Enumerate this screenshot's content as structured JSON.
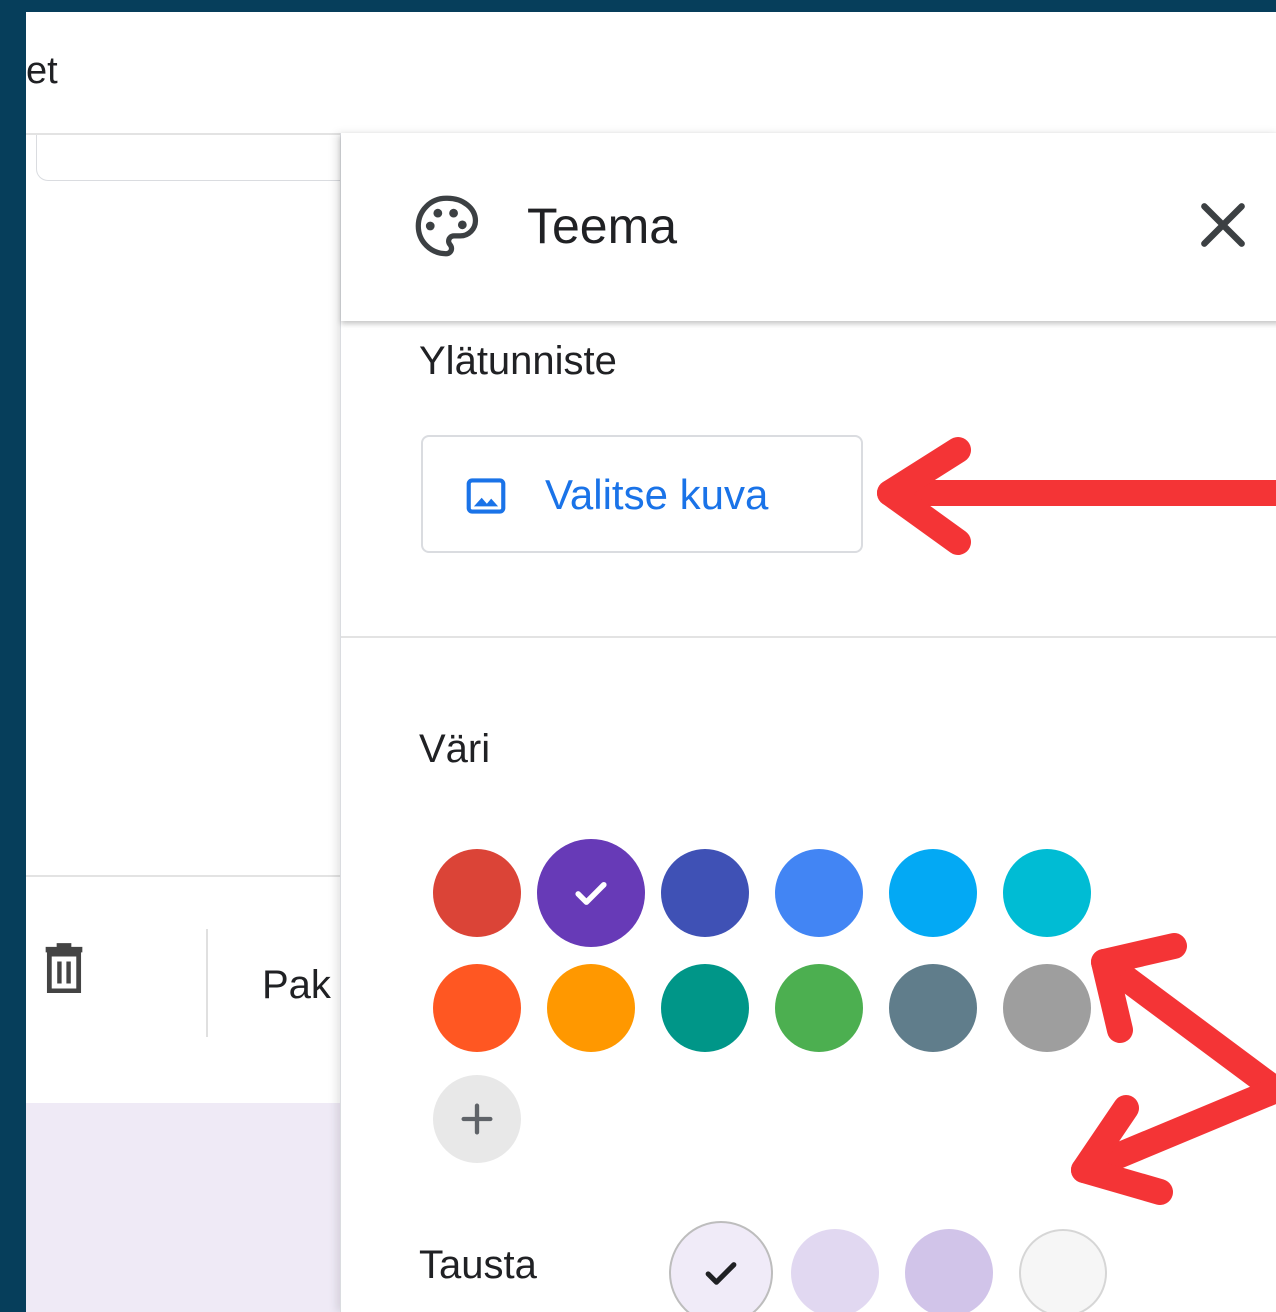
{
  "window": {
    "title_fragment": "et"
  },
  "left_toolbar": {
    "truncated_label": "Pak"
  },
  "panel": {
    "title": "Teema",
    "header_section": {
      "label": "Ylätunniste",
      "choose_image_label": "Valitse kuva"
    },
    "color_section": {
      "label": "Väri",
      "selected_color": "#673ab7",
      "swatches": [
        "#db4437",
        "#673ab7",
        "#3f51b5",
        "#4285f4",
        "#03a9f4",
        "#00bcd4",
        "#ff5722",
        "#ff9800",
        "#009688",
        "#4caf50",
        "#607d8b",
        "#9e9e9e"
      ],
      "add_color_symbol": "+"
    },
    "background_section": {
      "label": "Tausta",
      "swatches": [
        "#f0ebf8",
        "#e1d8f1",
        "#d1c4e9",
        "#f6f6f6"
      ],
      "selected_index": 0
    }
  },
  "annotation": {
    "arrow_color": "#f43436"
  },
  "icons": [
    "palette-icon",
    "close-icon",
    "image-icon",
    "trash-icon",
    "check-icon",
    "plus-icon"
  ]
}
